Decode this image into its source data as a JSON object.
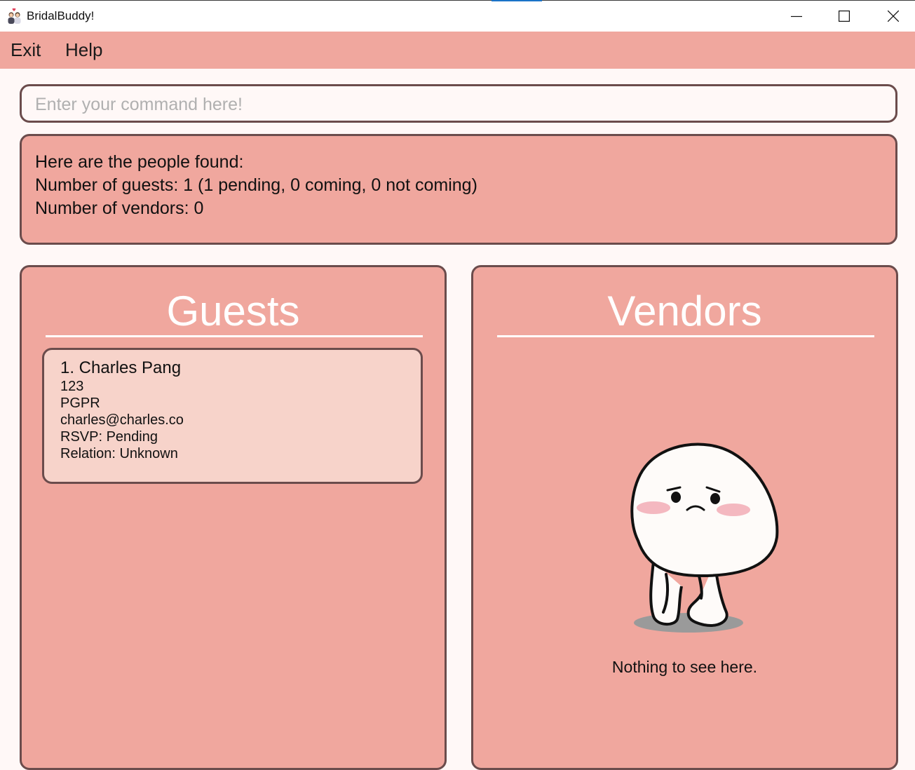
{
  "window": {
    "title": "BridalBuddy!",
    "icon": "couple-icon",
    "controls": [
      "minimize-icon",
      "maximize-icon",
      "close-icon"
    ]
  },
  "menu": {
    "items": [
      {
        "label": "Exit"
      },
      {
        "label": "Help"
      }
    ]
  },
  "command": {
    "placeholder": "Enter your command here!",
    "value": ""
  },
  "result": {
    "lines": [
      "Here are the people found:",
      "Number of guests: 1 (1 pending, 0 coming, 0 not coming)",
      "Number of vendors: 0"
    ]
  },
  "guests": {
    "title": "Guests",
    "items": [
      {
        "name": "1. Charles Pang",
        "phone": "123",
        "address": "PGPR",
        "email": "charles@charles.co",
        "rsvp": "RSVP: Pending",
        "relation": "Relation: Unknown"
      }
    ]
  },
  "vendors": {
    "title": "Vendors",
    "items": [],
    "empty_text": "Nothing to see here.",
    "empty_icon": "sad-mascot-icon"
  },
  "colors": {
    "background": "#fff8f7",
    "accent": "#f0a79e",
    "card": "#f7d3ca",
    "border": "#6b4c4c",
    "heading": "#ffffff"
  }
}
